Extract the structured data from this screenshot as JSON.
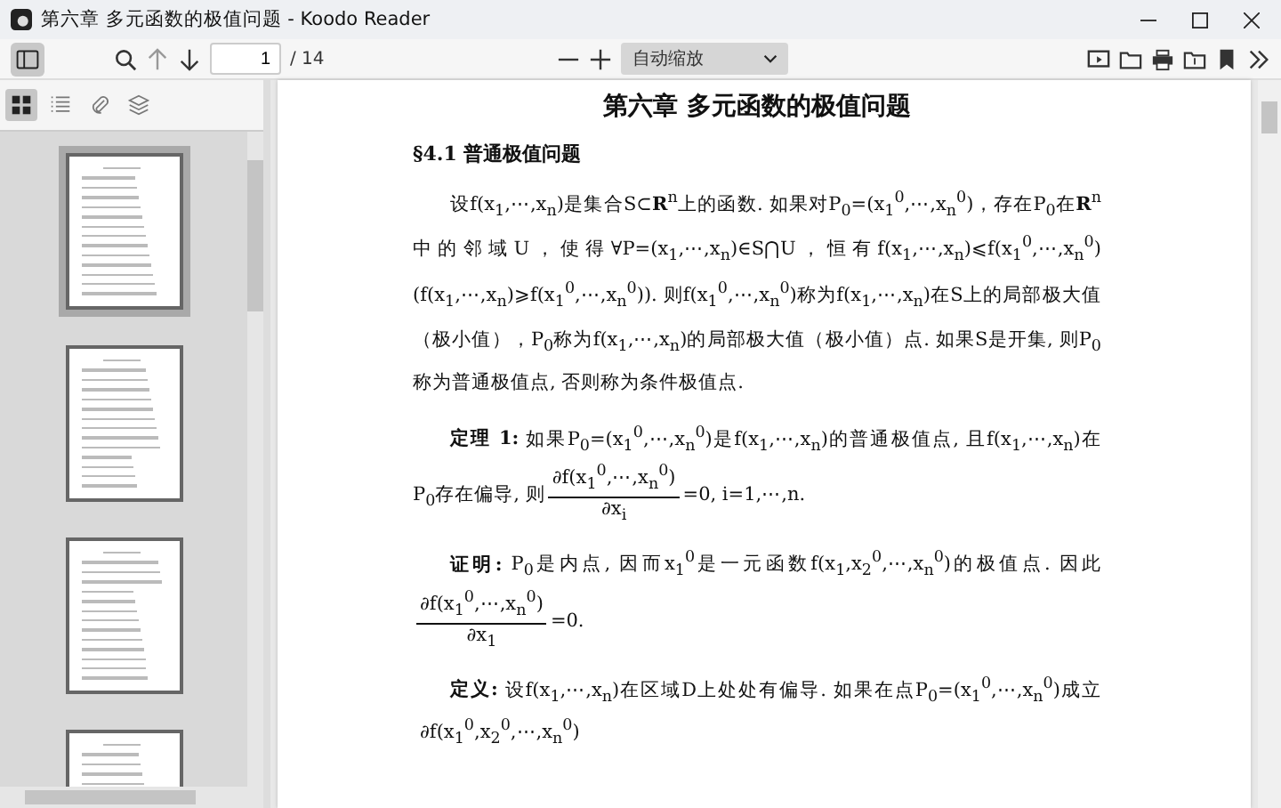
{
  "window": {
    "title": "第六章 多元函数的极值问题 - Koodo Reader"
  },
  "toolbar": {
    "page_input": {
      "value": "1"
    },
    "page_total": "/ 14",
    "zoom_select": {
      "value": "自动缩放"
    }
  },
  "sidebar": {
    "tabs": [
      {
        "selected": true
      },
      {
        "selected": false
      },
      {
        "selected": false
      },
      {
        "selected": false
      }
    ],
    "thumbnails": [
      {
        "selected": true
      },
      {
        "selected": false
      },
      {
        "selected": false
      },
      {
        "selected": false
      }
    ]
  },
  "document": {
    "chapter_title": "第六章  多元函数的极值问题",
    "section_heading": "§4.1  普通极值问题",
    "blocks": [
      {
        "kind": "paragraph",
        "text": "设f(x$_{1}$,⋯,x$_{n}$)是集合S⊂**R**$^{n}$上的函数. 如果对P$_{0}$=(x$_{1}$$^{0}$,⋯,x$_{n}$$^{0}$)，存在P$_{0}$在**R**$^{n}$中的邻域U，使得∀P=(x$_{1}$,⋯,x$_{n}$)∈S⋂U，恒有f(x$_{1}$,⋯,x$_{n}$)⩽f(x$_{1}$$^{0}$,⋯,x$_{n}$$^{0}$)(f(x$_{1}$,⋯,x$_{n}$)⩾f(x$_{1}$$^{0}$,⋯,x$_{n}$$^{0}$)). 则f(x$_{1}$$^{0}$,⋯,x$_{n}$$^{0}$)称为f(x$_{1}$,⋯,x$_{n}$)在S上的局部极大值（极小值），P$_{0}$称为f(x$_{1}$,⋯,x$_{n}$)的局部极大值（极小值）点. 如果S是开集, 则P$_{0}$称为普通极值点, 否则称为条件极值点."
      },
      {
        "kind": "statement",
        "label": "定理 1:",
        "text": "如果P$_{0}$=(x$_{1}$$^{0}$,⋯,x$_{n}$$^{0}$)是f(x$_{1}$,⋯,x$_{n}$)的普通极值点, 且f(x$_{1}$,⋯,x$_{n}$)在P$_{0}$存在偏导, 则",
        "numerator": "∂f(x$_{1}$$^{0}$,⋯,x$_{n}$$^{0}$)",
        "denominator": "∂x$_{i}$",
        "after": "=0, i=1,⋯,n."
      },
      {
        "kind": "statement",
        "label": "证明:",
        "text": "P$_{0}$是内点, 因而x$_{1}$$^{0}$是一元函数f(x$_{1}$,x$_{2}$$^{0}$,⋯,x$_{n}$$^{0}$)的极值点. 因此",
        "numerator": "∂f(x$_{1}$$^{0}$,⋯,x$_{n}$$^{0}$)",
        "denominator": "∂x$_{1}$",
        "after": "=0."
      },
      {
        "kind": "statement",
        "label": "定义:",
        "text": "设f(x$_{1}$,⋯,x$_{n}$)在区域D上处处有偏导. 如果在点P$_{0}$=(x$_{1}$$^{0}$,⋯,x$_{n}$$^{0}$)成立",
        "numerator": "∂f(x$_{1}$$^{0}$,x$_{2}$$^{0}$,⋯,x$_{n}$$^{0}$)"
      }
    ]
  }
}
